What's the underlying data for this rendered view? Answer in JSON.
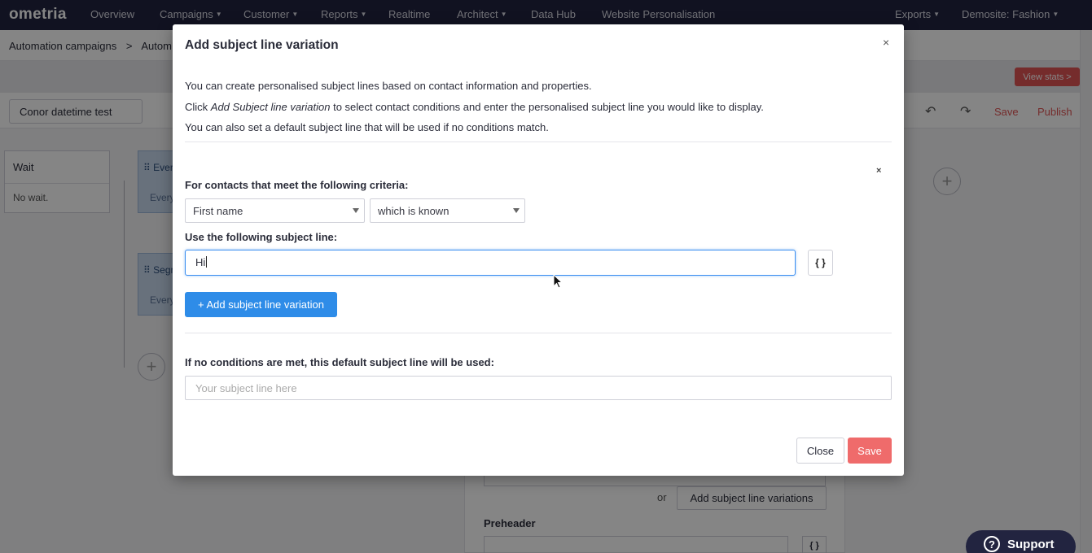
{
  "nav": {
    "logo": "ometria",
    "items": [
      {
        "label": "Overview",
        "caret": false
      },
      {
        "label": "Campaigns",
        "caret": true
      },
      {
        "label": "Customer",
        "caret": true
      },
      {
        "label": "Reports",
        "caret": true
      },
      {
        "label": "Realtime",
        "caret": false
      },
      {
        "label": "Architect",
        "caret": true
      },
      {
        "label": "Data Hub",
        "caret": false
      },
      {
        "label": "Website Personalisation",
        "caret": false
      }
    ],
    "exports": "Exports",
    "site": "Demosite: Fashion"
  },
  "breadcrumb": {
    "part1": "Automation campaigns",
    "sep": ">",
    "part2": "Autom"
  },
  "toolbar": {
    "campaign_name": "Conor datetime test",
    "view_stats": "View stats >",
    "save": "Save",
    "publish": "Publish"
  },
  "canvas": {
    "wait_title": "Wait",
    "wait_desc": "No wait.",
    "node1_title": "Every",
    "node1_desc": "Every",
    "node2_title": "Segm",
    "node2_desc": "Every",
    "or_text": "or",
    "add_variations": "Add subject line variations",
    "preheader": "Preheader",
    "brace": "{ }"
  },
  "support": "Support",
  "modal": {
    "title": "Add subject line variation",
    "close_x": "×",
    "intro1": "You can create personalised subject lines based on contact information and properties.",
    "intro2_pre": "Click ",
    "intro2_em": "Add Subject line variation",
    "intro2_post": " to select contact conditions and enter the personalised subject line you would like to display.",
    "intro3": "You can also set a default subject line that will be used if no conditions match.",
    "condition_remove": "×",
    "criteria_label": "For contacts that meet the following criteria:",
    "field_select": "First name",
    "operator_select": "which is known",
    "subject_label": "Use the following subject line:",
    "subject_value": "Hi",
    "brace_btn": "{ }",
    "add_variation_btn": "+ Add subject line variation",
    "default_label": "If no conditions are met, this default subject line will be used:",
    "default_placeholder": "Your subject line here",
    "close_btn": "Close",
    "save_btn": "Save"
  }
}
